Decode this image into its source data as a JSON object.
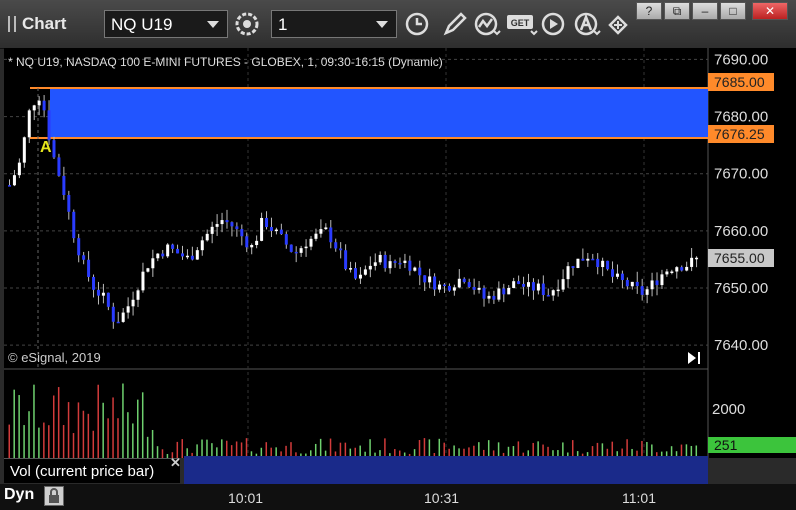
{
  "window": {
    "title": "Chart",
    "symbol": "NQ U19",
    "interval": "1",
    "controls": [
      "minimize-button",
      "restore-button",
      "maximize-button",
      "close-button"
    ]
  },
  "toolbar": {
    "icons": [
      "settings-icon",
      "clock-icon",
      "pencil-icon",
      "studies-icon",
      "get-icon",
      "play-icon",
      "alert-icon",
      "cursor-icon"
    ],
    "get_label": "GET"
  },
  "chart": {
    "info_line": "* NQ U19, NASDAQ 100 E-MINI FUTURES - GLOBEX, 1, 09:30-16:15 (Dynamic)",
    "copyright": "© eSignal, 2019",
    "marker_label": "A",
    "price_axis": [
      "7690.00",
      "7680.00",
      "7670.00",
      "7660.00",
      "7650.00",
      "7640.00"
    ],
    "price_badges": {
      "upper": "7685.00",
      "lower": "7676.25",
      "last": "7655.00"
    },
    "volume_axis": [
      "2000"
    ],
    "volume_badge": "251",
    "time_axis": [
      "10:01",
      "10:31",
      "11:01"
    ],
    "colors": {
      "zone": "#2255ff",
      "zone_line": "#ff8a2a",
      "volume_up": "#6fd16f",
      "volume_down": "#d23b3b",
      "candle_up": "#ffffff",
      "candle_down": "#2a3cff",
      "volume_badge": "#3cc43c"
    }
  },
  "volume_panel": {
    "label": "Vol (current price bar)"
  },
  "status": {
    "label": "Dyn"
  },
  "chart_data": {
    "type": "candlestick",
    "y_range": [
      7636,
      7692
    ],
    "zone": {
      "high": 7685.0,
      "low": 7676.25
    },
    "candles_close_path": [
      7668,
      7672,
      7682,
      7684,
      7674,
      7668,
      7660,
      7654,
      7650,
      7648,
      7644,
      7646,
      7650,
      7654,
      7656,
      7657,
      7656,
      7655,
      7658,
      7660,
      7662,
      7661,
      7659,
      7657,
      7662,
      7660,
      7658,
      7656,
      7658,
      7659,
      7660,
      7657,
      7653,
      7651,
      7654,
      7655,
      7654,
      7655,
      7654,
      7652,
      7651,
      7650,
      7651,
      7652,
      7650,
      7648,
      7649,
      7650,
      7651,
      7650,
      7650,
      7649,
      7651,
      7654,
      7655,
      7656,
      7654,
      7652,
      7651,
      7650,
      7649,
      7651,
      7653,
      7654,
      7654,
      7655
    ],
    "volume_max": 2000
  }
}
